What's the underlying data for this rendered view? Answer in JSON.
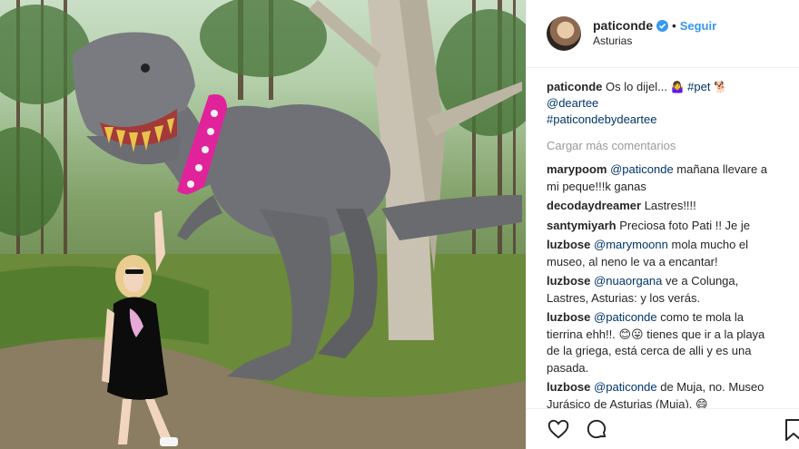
{
  "post": {
    "username": "paticonde",
    "follow_label": "Seguir",
    "location": "Asturias"
  },
  "caption": {
    "username": "paticonde",
    "text": "Os lo dijel... ",
    "emoji_1": "🤷‍♀️",
    "hashtag_pet": "#pet",
    "emoji_2": "🐕",
    "mention": "@deartee",
    "hashtag_2": "#paticondebydeartee"
  },
  "load_more": "Cargar más comentarios",
  "comments": [
    {
      "user": "marypoom",
      "mention": "@paticonde",
      "text": " mañana llevare a mi peque!!!k ganas"
    },
    {
      "user": "decodaydreamer",
      "mention": "",
      "text": "Lastres!!!!"
    },
    {
      "user": "santymiyarh",
      "mention": "",
      "text": "Preciosa foto Pati !! Je je"
    },
    {
      "user": "luzbose",
      "mention": "@marymoonn",
      "text": " mola mucho el museo, al neno le va a encantar!"
    },
    {
      "user": "luzbose",
      "mention": "@nuaorgana",
      "text": " ve a Colunga, Lastres, Asturias: y los verás."
    },
    {
      "user": "luzbose",
      "mention": "@paticonde",
      "text": " como te mola la tierrina ehh!!. 😊😛 tienes que ir a la playa de la griega, está cerca de alli y es una pasada."
    },
    {
      "user": "luzbose",
      "mention": "@paticonde",
      "text": " de Muja, no. Museo Jurásico de Asturias (Muja). 😄"
    }
  ],
  "icons": {
    "like": "heart-icon",
    "comment": "comment-icon",
    "save": "bookmark-icon",
    "verified": "verified-badge-icon"
  },
  "colors": {
    "accent": "#3897f0",
    "link": "#003569",
    "muted": "#999999",
    "collar": "#e0239b"
  }
}
